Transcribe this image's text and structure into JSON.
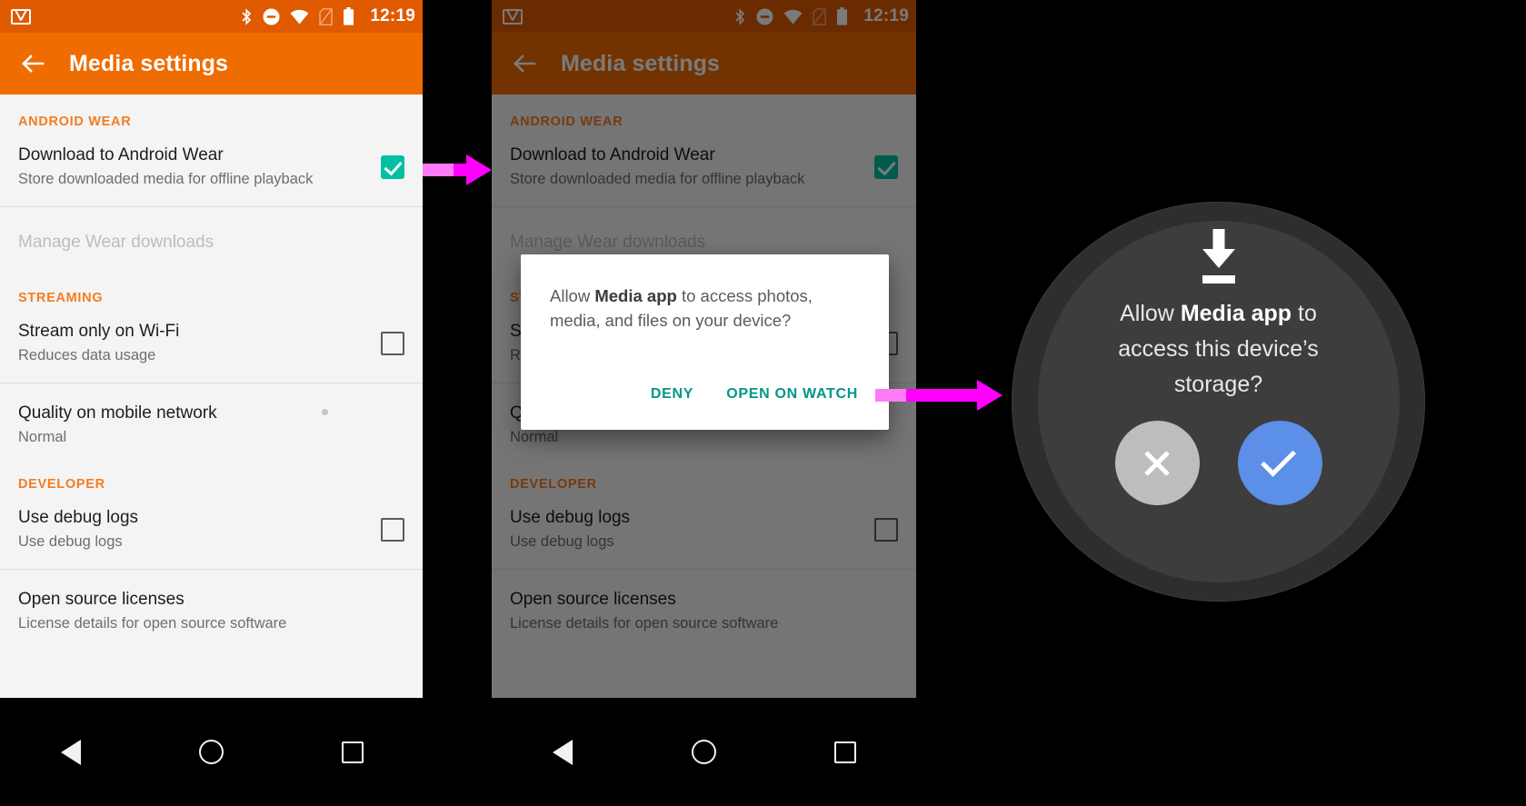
{
  "status_bar": {
    "app_icon": "gmail-icon",
    "icons": [
      "bluetooth-icon",
      "do-not-disturb-icon",
      "wifi-icon",
      "no-sim-icon",
      "battery-icon"
    ],
    "time": "12:19"
  },
  "app_bar": {
    "back_icon": "arrow-back-icon",
    "title": "Media settings"
  },
  "settings": {
    "sections": [
      {
        "header": "ANDROID WEAR",
        "rows": [
          {
            "title": "Download to Android Wear",
            "subtitle": "Store downloaded media for offline playback",
            "control": "checkbox",
            "checked": true,
            "disabled": false
          },
          {
            "title": "Manage Wear downloads",
            "subtitle": "",
            "control": "none",
            "checked": false,
            "disabled": true
          }
        ]
      },
      {
        "header": "STREAMING",
        "rows": [
          {
            "title": "Stream only on Wi-Fi",
            "subtitle": "Reduces data usage",
            "control": "checkbox",
            "checked": false,
            "disabled": false
          },
          {
            "title": "Quality on mobile network",
            "subtitle": "Normal",
            "control": "none",
            "checked": false,
            "disabled": false
          }
        ]
      },
      {
        "header": "DEVELOPER",
        "rows": [
          {
            "title": "Use debug logs",
            "subtitle": "Use debug logs",
            "control": "checkbox",
            "checked": false,
            "disabled": false
          },
          {
            "title": "Open source licenses",
            "subtitle": "License details for open source software",
            "control": "none",
            "checked": false,
            "disabled": false
          }
        ]
      }
    ]
  },
  "dialog": {
    "message_prefix": "Allow ",
    "message_app": "Media app",
    "message_suffix": " to access photos, media, and files on your device?",
    "deny_label": "DENY",
    "open_on_watch_label": "OPEN ON WATCH"
  },
  "watch": {
    "icon": "download-icon",
    "message_prefix": "Allow ",
    "message_app": "Media app",
    "message_suffix": "  to access this device’s storage?",
    "deny_icon": "close-icon",
    "allow_icon": "check-icon"
  },
  "nav_bar": {
    "back_icon": "nav-back-icon",
    "home_icon": "nav-home-icon",
    "recents_icon": "nav-recents-icon"
  },
  "arrows": {
    "flow_1": "flow-arrow",
    "flow_2": "flow-arrow"
  },
  "colors": {
    "status_bar": "#e05a00",
    "app_bar": "#ef6c00",
    "section_header": "#f57c20",
    "checkbox_checked": "#00bfa5",
    "dialog_action": "#009688",
    "arrow": "#ff00ff",
    "watch_allow": "#5b8fe8",
    "watch_deny": "#bdbdbd"
  }
}
